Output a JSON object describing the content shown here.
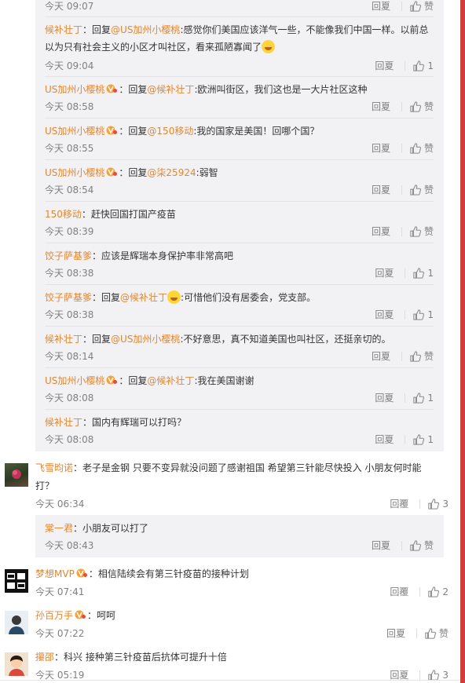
{
  "colors": {
    "accent": "#e3862f",
    "panel": "#f2f2f5",
    "meta": "#808080",
    "right_bar": "#cf3d3d"
  },
  "labels": {
    "reply": "回覆",
    "reply_alt": "回夏"
  },
  "replies": [
    {
      "time": "今天 09:07",
      "likes": "",
      "like_label": "赞"
    },
    {
      "name": "候补壮丁",
      "mid1": "：回复",
      "mention": "@US加州小樱桃",
      "text": ":感觉你们美国应该洋气一些，不能像我们中国一样。以前总以为只有社会主义的小区才叫社区，看来孤陋寡闻了",
      "time": "今天 09:04",
      "likes": "1"
    },
    {
      "name": "US加州小樱桃",
      "mid1": "：回复",
      "mention": "@候补壮丁",
      "text": ":欧洲叫街区，我们这也是一大片社区这种",
      "time": "今天 08:58",
      "like_label": "赞"
    },
    {
      "name": "US加州小樱桃",
      "mid1": "：回复",
      "mention": "@150移动",
      "text": ":我的国家是美国！回哪个国？",
      "time": "今天 08:55",
      "like_label": "赞"
    },
    {
      "name": "US加州小樱桃",
      "mid1": "：回复",
      "mention": "@柒25924",
      "text": ":弱智",
      "time": "今天 08:54",
      "like_label": "赞"
    },
    {
      "name": "150移动",
      "mid1": "：赶快回国打国产疫苗",
      "time": "今天 08:39",
      "like_label": "赞"
    },
    {
      "name": "饺子萨基爹",
      "mid1": "：应该是辉瑞本身保护率非常高吧",
      "time": "今天 08:38",
      "likes": "1"
    },
    {
      "name": "饺子萨基爹",
      "mid1": "：回复",
      "mention": "@候补壮丁",
      "text": ":可惜他们没有居委会，党支部。",
      "time": "今天 08:38",
      "likes": "1"
    },
    {
      "name": "候补壮丁",
      "mid1": "：回复",
      "mention": "@US加州小樱桃",
      "text": ":不好意思，真不知道美国也叫社区，还挺亲切的。",
      "time": "今天 08:14",
      "like_label": "赞"
    },
    {
      "name": "US加州小樱桃",
      "mid1": "：回复",
      "mention": "@候补壮丁",
      "text": ":我在美国谢谢",
      "time": "今天 08:08",
      "likes": "1"
    },
    {
      "name": "候补壮丁",
      "mid1": "：国内有辉瑞可以打吗？",
      "time": "今天 08:08",
      "likes": "1"
    }
  ],
  "comments": [
    {
      "name": "飞雪昀诺",
      "text": "：老子是金钢 只要不变异就没问题了感谢祖国  希望第三针能尽快投入     小朋友何时能打？",
      "time": "今天 06:34",
      "likes": "3",
      "sub": {
        "name": "棠一君",
        "text": "：小朋友可以打了",
        "time": "今天 08:43",
        "like_label": "赞"
      }
    },
    {
      "name": "梦想MVP",
      "text": "：相信陆续会有第三针疫苗的接种计划",
      "time": "今天 07:41",
      "likes": "2",
      "avatar_text": "做\n就\n成\n功"
    },
    {
      "name": "孙百万手",
      "text": "：呵呵",
      "time": "今天 07:22",
      "like_label": "赞"
    },
    {
      "name": "攥邵",
      "text": "：科兴 接种第三针疫苗后抗体可提升十倍",
      "time": "今天 05:19",
      "likes": "3"
    }
  ]
}
